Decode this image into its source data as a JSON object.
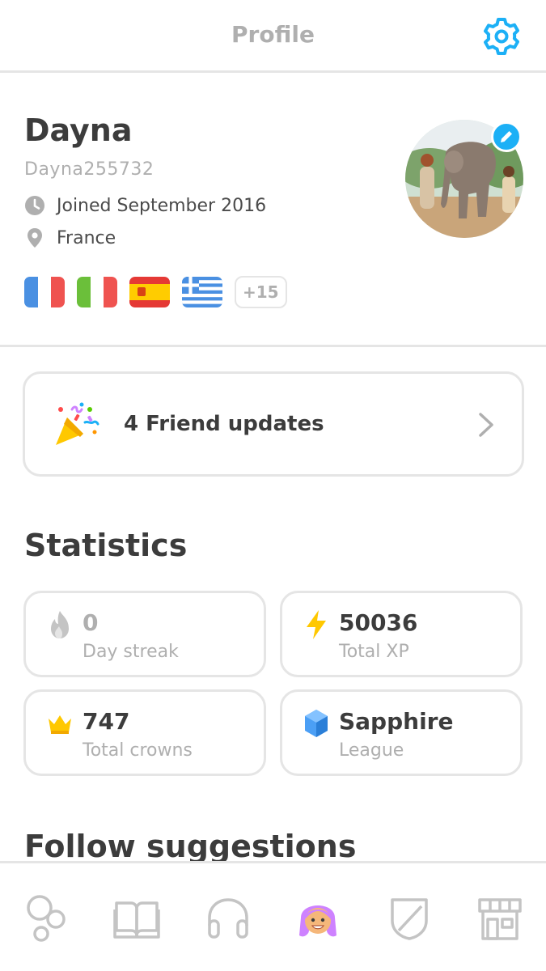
{
  "header": {
    "title": "Profile",
    "settings_icon": "gear-icon"
  },
  "profile": {
    "name": "Dayna",
    "username": "Dayna255732",
    "joined": "Joined September 2016",
    "location": "France",
    "flags": [
      "france-flag",
      "italy-flag",
      "spain-flag",
      "greece-flag"
    ],
    "more_languages": "+15",
    "avatar": "profile-photo-elephant",
    "edit_icon": "pencil-icon"
  },
  "friend_updates": {
    "label": "4 Friend updates",
    "icon": "party-popper-icon"
  },
  "statistics": {
    "title": "Statistics",
    "items": [
      {
        "value": "0",
        "label": "Day streak",
        "icon": "flame-icon"
      },
      {
        "value": "50036",
        "label": "Total XP",
        "icon": "lightning-icon"
      },
      {
        "value": "747",
        "label": "Total crowns",
        "icon": "crown-icon"
      },
      {
        "value": "Sapphire",
        "label": "League",
        "icon": "sapphire-gem-icon"
      }
    ]
  },
  "follow": {
    "title": "Follow suggestions"
  },
  "tabs": [
    {
      "name": "learn",
      "icon": "bubbles-icon"
    },
    {
      "name": "stories",
      "icon": "book-icon"
    },
    {
      "name": "podcast",
      "icon": "headphones-icon"
    },
    {
      "name": "profile",
      "icon": "avatar-icon",
      "active": true
    },
    {
      "name": "leagues",
      "icon": "shield-icon"
    },
    {
      "name": "shop",
      "icon": "shop-icon"
    }
  ],
  "colors": {
    "accent_blue": "#1cb0f6",
    "gray_text": "#afafaf",
    "dark_text": "#3c3c3c",
    "border": "#e5e5e5",
    "xp_yellow": "#ffc800",
    "sapphire": "#4b9ff5"
  }
}
